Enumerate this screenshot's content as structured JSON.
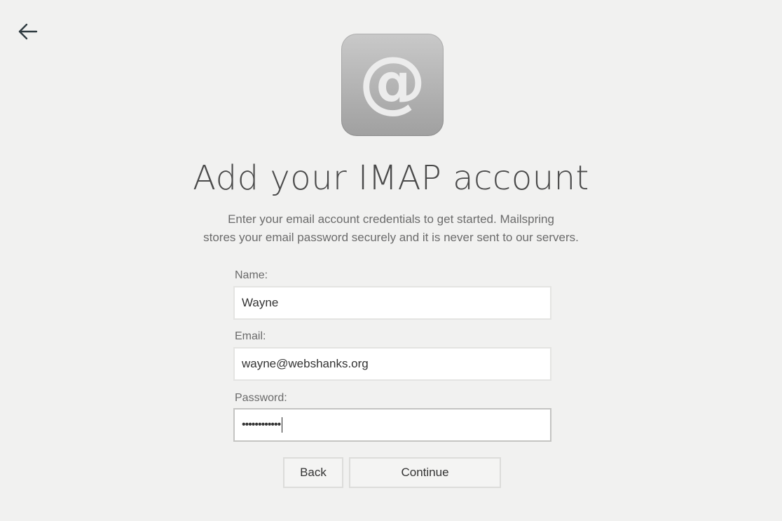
{
  "nav": {
    "back_icon": "arrow-left-icon"
  },
  "hero": {
    "icon": "at-sign-icon",
    "icon_glyph": "@",
    "title": "Add your IMAP account",
    "subtitle_line1": "Enter your email account credentials to get started. Mailspring",
    "subtitle_line2": "stores your email password securely and it is never sent to our servers."
  },
  "form": {
    "name_label": "Name:",
    "name_value": "Wayne",
    "email_label": "Email:",
    "email_value": "wayne@webshanks.org",
    "password_label": "Password:",
    "password_masked": "••••••••••••"
  },
  "buttons": {
    "back_label": "Back",
    "continue_label": "Continue"
  }
}
